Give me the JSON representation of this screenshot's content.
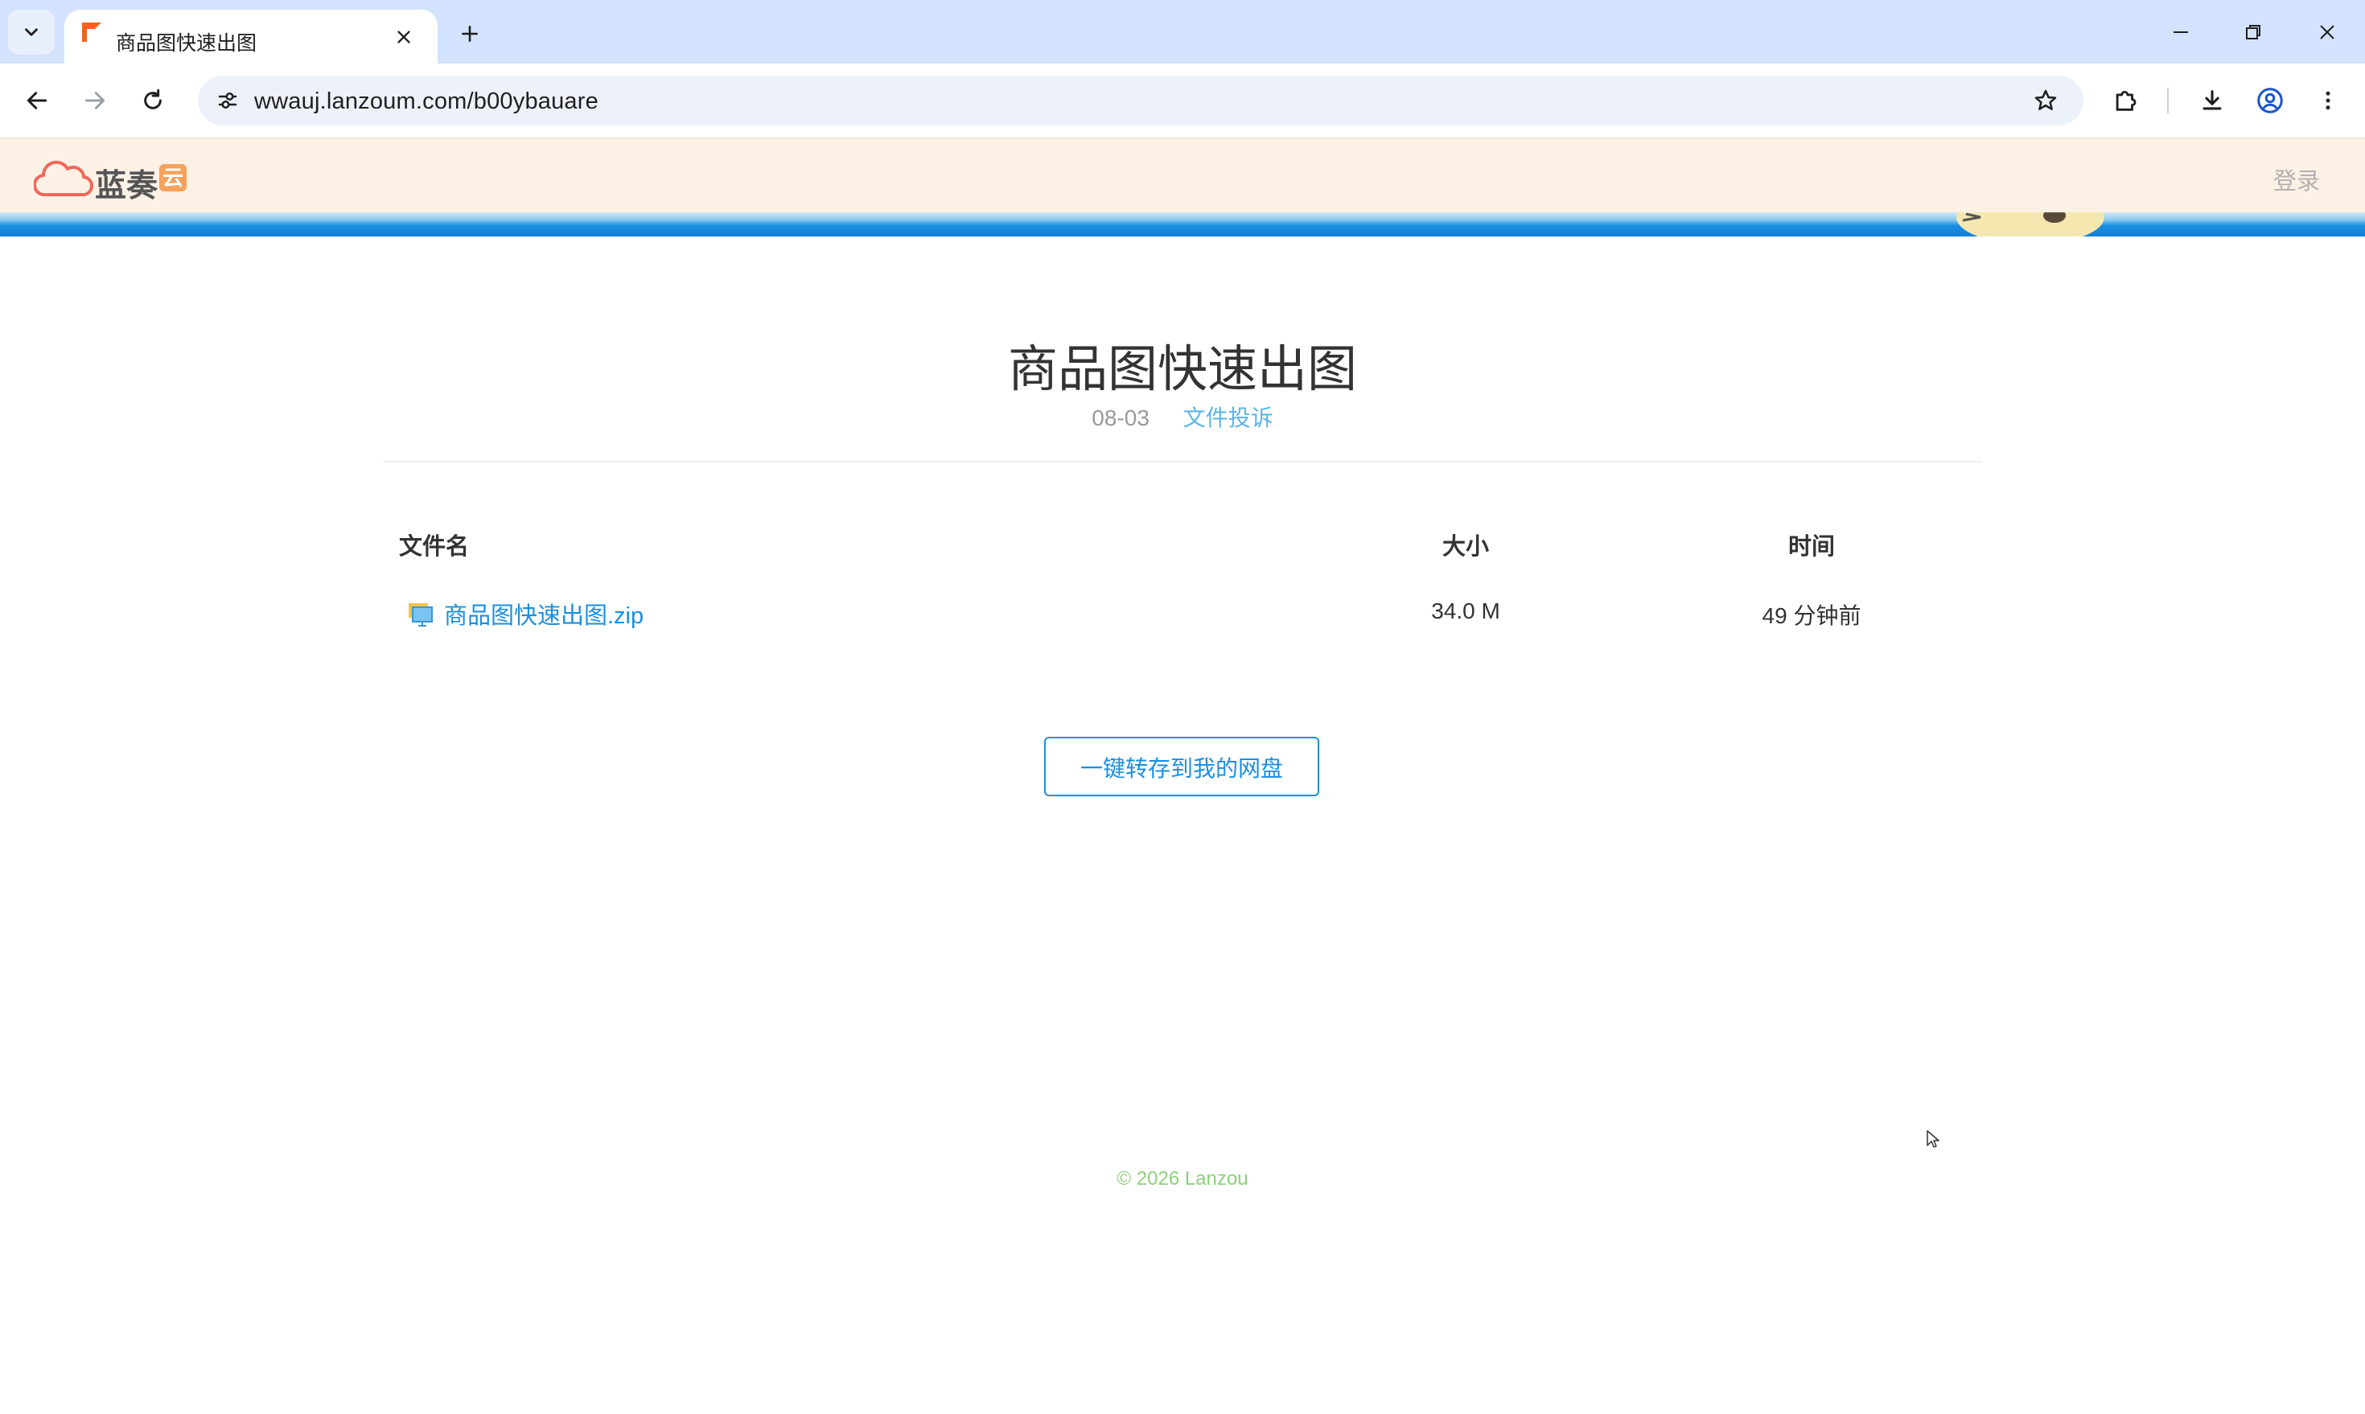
{
  "browser": {
    "tab_title": "商品图快速出图",
    "url": "wwauj.lanzoum.com/b00ybauare",
    "icons": {
      "tab_search": "chevron-down-icon",
      "close_tab": "close-icon",
      "new_tab": "plus-icon",
      "back": "arrow-left-icon",
      "forward": "arrow-right-icon",
      "reload": "reload-icon",
      "site_info": "tune-icon",
      "bookmark": "star-icon",
      "extensions": "puzzle-icon",
      "downloads": "download-icon",
      "profile": "account-icon",
      "menu": "kebab-menu-icon",
      "minimize": "minimize-icon",
      "restore": "restore-icon",
      "close_window": "close-icon"
    }
  },
  "site": {
    "logo_text": "蓝奏",
    "logo_badge": "云",
    "login_label": "登录"
  },
  "page": {
    "title": "商品图快速出图",
    "date": "08-03",
    "report_label": "文件投诉"
  },
  "table": {
    "headers": {
      "name": "文件名",
      "size": "大小",
      "time": "时间"
    },
    "rows": [
      {
        "name": "商品图快速出图.zip",
        "size": "34.0 M",
        "time": "49 分钟前"
      }
    ]
  },
  "actions": {
    "save_label": "一键转存到我的网盘"
  },
  "footer": {
    "copyright": "© 2026 Lanzou"
  },
  "colors": {
    "accent": "#1a8fe0",
    "header_bg": "#fdf1e6",
    "footer_text": "#8cd07a",
    "chrome_bg": "#d3e3fd"
  }
}
